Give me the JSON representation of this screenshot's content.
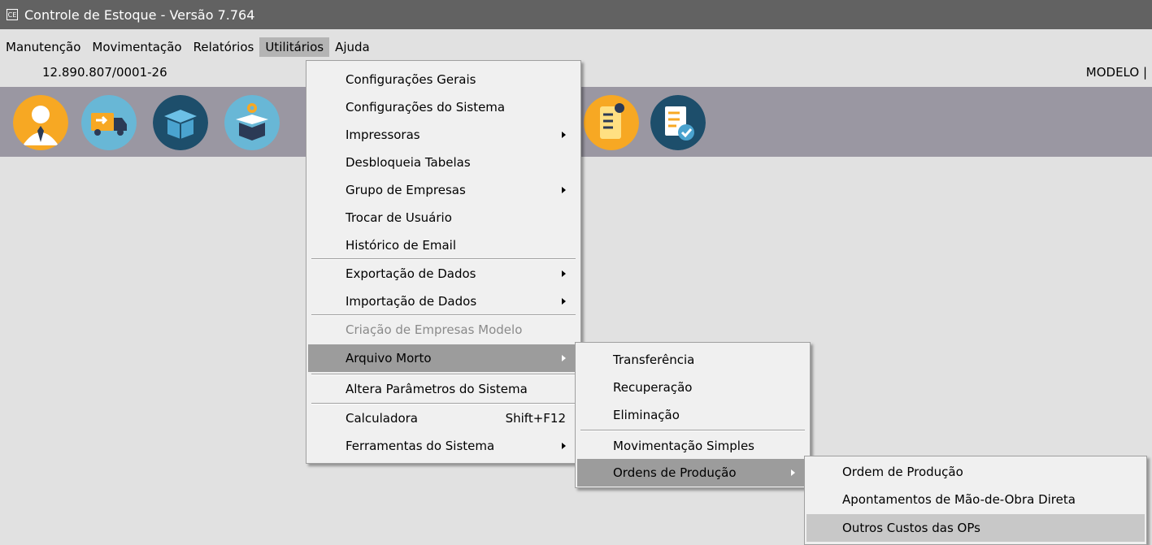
{
  "window": {
    "icon_text": "CE",
    "title": "Controle de Estoque - Versão 7.764"
  },
  "menubar": [
    {
      "label": "Manutenção"
    },
    {
      "label": "Movimentação"
    },
    {
      "label": "Relatórios"
    },
    {
      "label": "Utilitários"
    },
    {
      "label": "Ajuda"
    }
  ],
  "info": {
    "cnpj": "12.890.807/0001-26",
    "company": "MODELO | N"
  },
  "toolbar": {
    "icons": [
      "user-icon",
      "delivery-truck-icon",
      "box-icon",
      "box-settings-icon",
      "checklist-location-icon",
      "report-check-icon"
    ]
  },
  "utilitarios_menu": {
    "items": [
      {
        "label": "Configurações Gerais"
      },
      {
        "label": "Configurações do Sistema"
      },
      {
        "label": "Impressoras"
      },
      {
        "label": "Desbloqueia Tabelas"
      },
      {
        "label": "Grupo de Empresas"
      },
      {
        "label": "Trocar de Usuário"
      },
      {
        "label": "Histórico de Email"
      },
      {
        "label": "Exportação de Dados"
      },
      {
        "label": "Importação de Dados"
      },
      {
        "label": "Criação de Empresas Modelo"
      },
      {
        "label": "Arquivo Morto"
      },
      {
        "label": "Altera Parâmetros do Sistema"
      },
      {
        "label": "Calculadora",
        "shortcut": "Shift+F12"
      },
      {
        "label": "Ferramentas do Sistema"
      }
    ]
  },
  "arquivo_morto_menu": {
    "items": [
      {
        "label": "Transferência"
      },
      {
        "label": "Recuperação"
      },
      {
        "label": "Eliminação"
      },
      {
        "label": "Movimentação Simples"
      },
      {
        "label": "Ordens de Produção"
      }
    ]
  },
  "ordens_menu": {
    "items": [
      {
        "label": "Ordem de Produção"
      },
      {
        "label": "Apontamentos de Mão-de-Obra Direta"
      },
      {
        "label": "Outros Custos das OPs"
      }
    ]
  },
  "colors": {
    "titlebar": "#626262",
    "toolbar": "#9a97a2",
    "menu_bg": "#f0f0f0",
    "highlight": "#9c9c9c",
    "background": "#e1e1e1"
  }
}
